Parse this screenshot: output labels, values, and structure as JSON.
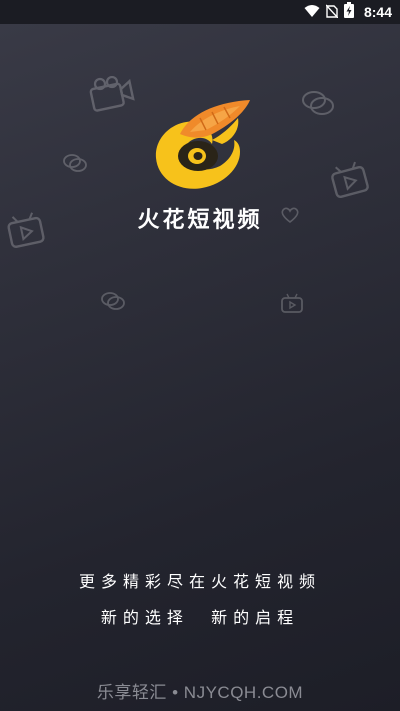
{
  "status_bar": {
    "time": "8:44",
    "icons": [
      "wifi-icon",
      "no-sim-icon",
      "battery-charging-icon"
    ]
  },
  "splash": {
    "app_name": "火花短视频",
    "slogan_line1": "更多精彩尽在火花短视频",
    "slogan_line2": "新的选择  新的启程"
  },
  "watermark": "乐享轻汇 • NJYCQH.COM",
  "colors": {
    "background_top": "#3a3b47",
    "background_bottom": "#1d1e27",
    "logo_orange": "#f08a2a",
    "logo_yellow": "#f7c21b"
  }
}
